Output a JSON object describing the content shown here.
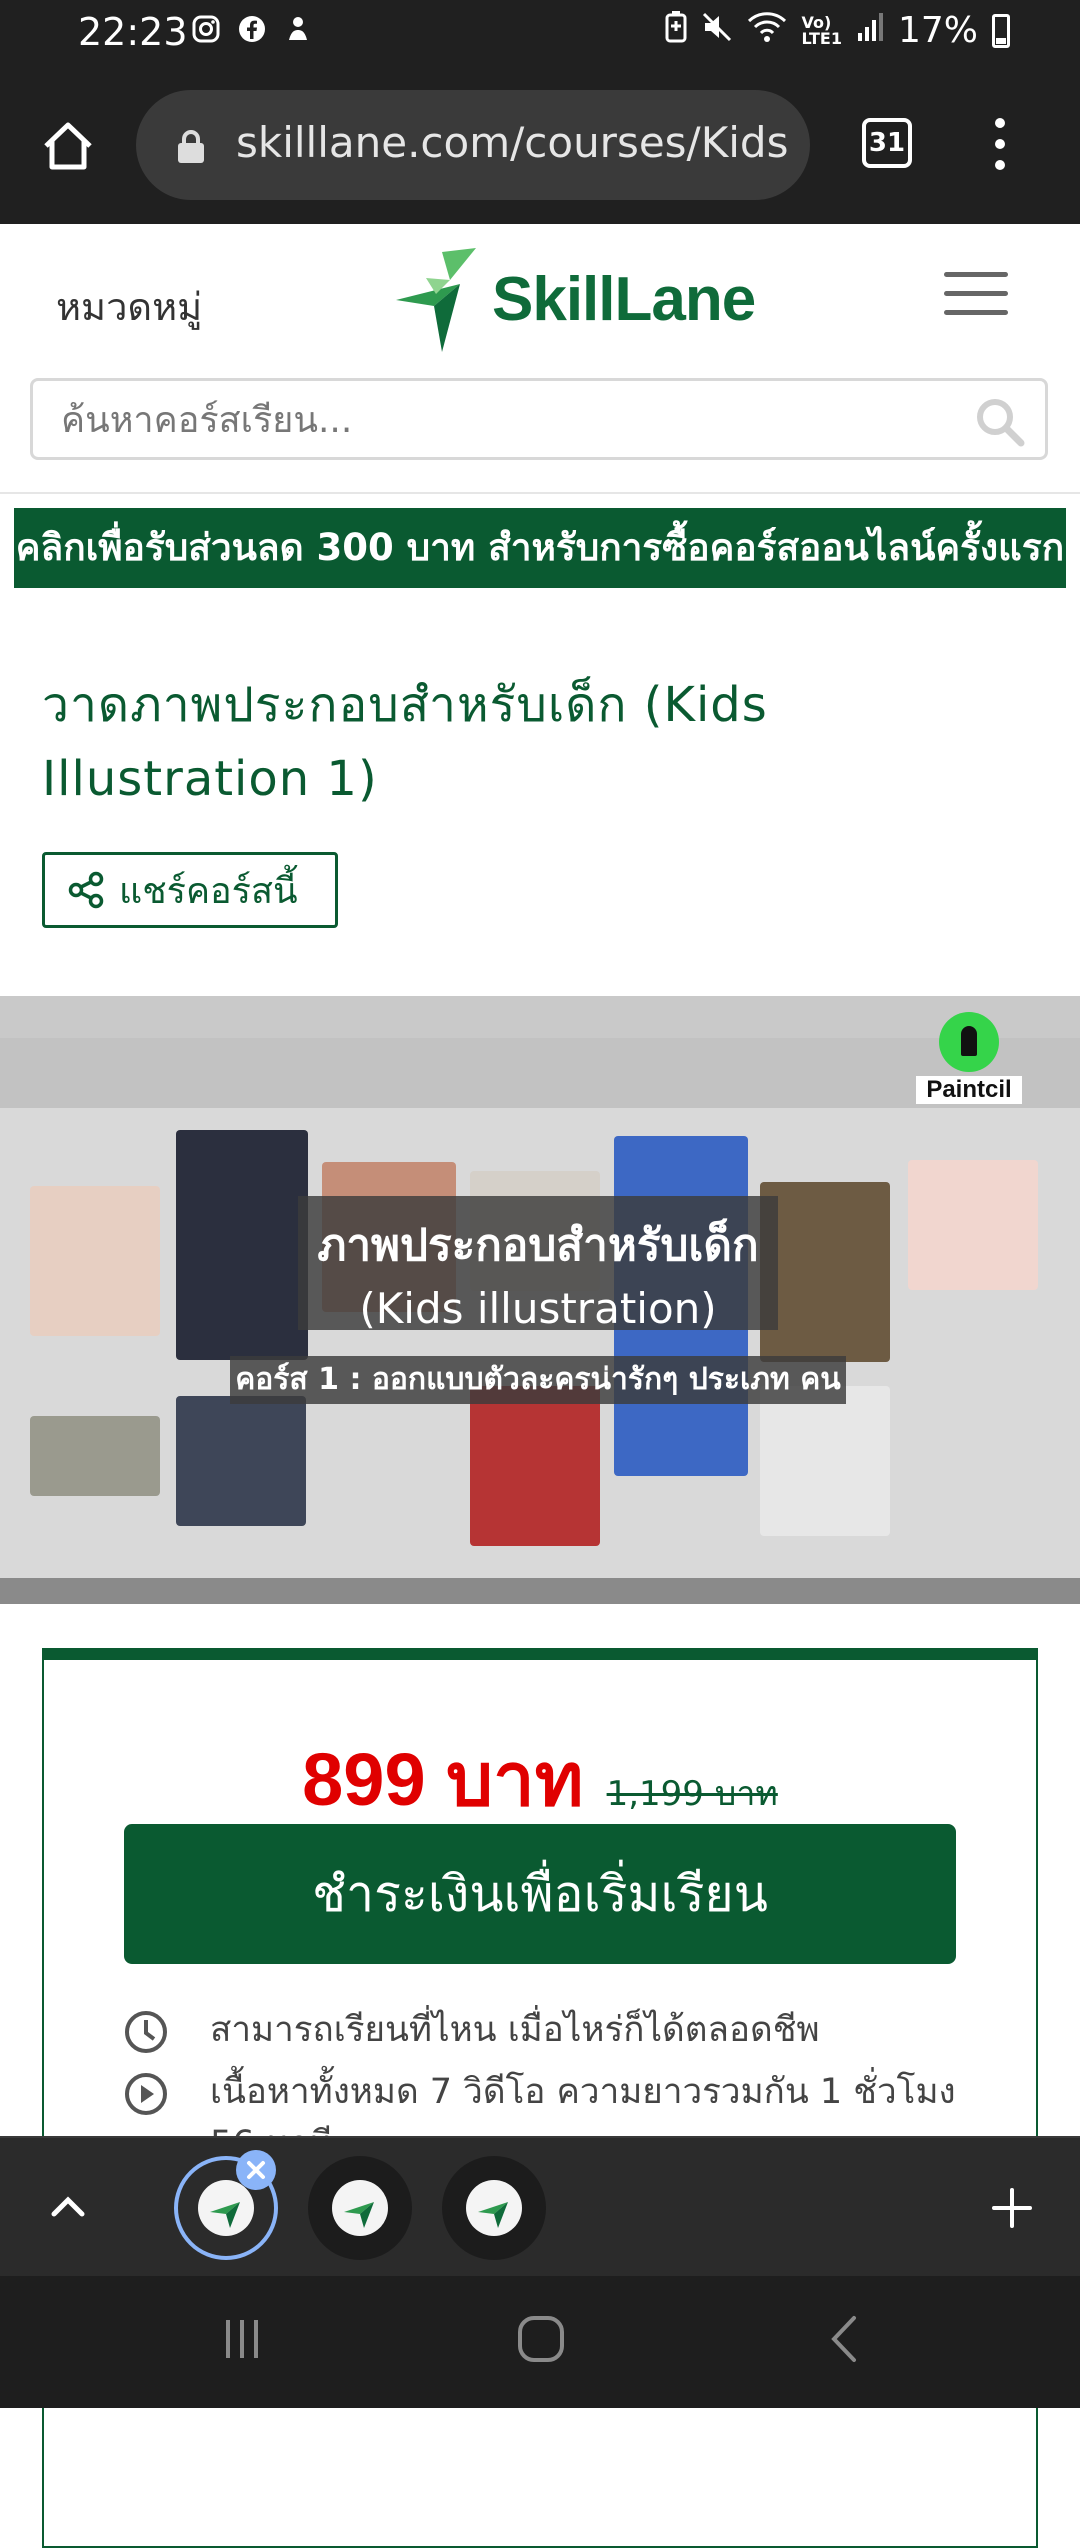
{
  "status_bar": {
    "time": "22:23",
    "battery": "17%",
    "icons": [
      "instagram-icon",
      "facebook-icon",
      "notification-icon",
      "battery-saver-icon",
      "mute-icon",
      "wifi-icon",
      "volte-icon",
      "signal-icon"
    ]
  },
  "browser": {
    "url": "skilllane.com/courses/Kids",
    "tab_count": "31"
  },
  "header": {
    "categories": "หมวดหมู่",
    "logo_text": "SkillLane",
    "search_placeholder": "ค้นหาคอร์สเรียน..."
  },
  "promo": "คลิกเพื่อรับส่วนลด 300 บาท สำหรับการซื้อคอร์สออนไลน์ครั้งแรก",
  "course": {
    "title": "วาดภาพประกอบสำหรับเด็ก (Kids Illustration 1)",
    "share_label": "แชร์คอร์สนี้"
  },
  "video": {
    "overlay_title_line1": "ภาพประกอบสำหรับเด็ก",
    "overlay_title_line2": "(Kids illustration)",
    "overlay_subtitle": "คอร์ส 1 : ออกแบบตัวละครน่ารักๆ ประเภท คน",
    "brand": "Paintcil"
  },
  "pricing": {
    "price": "899 บาท",
    "old_price": "1,199 บาท",
    "pay_button": "ชำระเงินเพื่อเริ่มเรียน",
    "features": [
      "สามารถเรียนที่ไหน เมื่อไหร่ก็ได้ตลอดชีพ",
      "เนื้อหาทั้งหมด 7 วิดีโอ ความยาวรวมกัน 1 ชั่วโมง 56 นาที"
    ]
  },
  "colors": {
    "brand_green": "#0a5a31",
    "price_red": "#e00000",
    "chrome_dark": "#202020"
  }
}
